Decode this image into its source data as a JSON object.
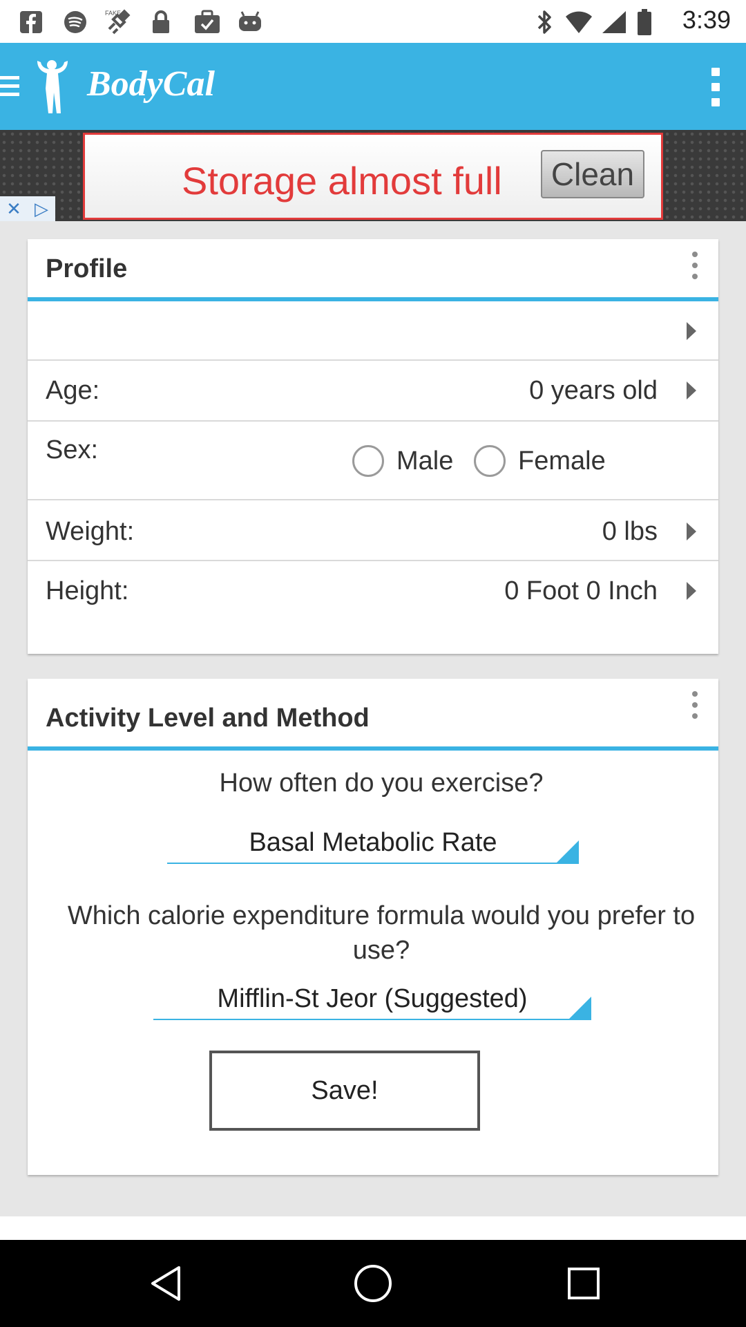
{
  "status_bar": {
    "time": "3:39",
    "left_icons": [
      "facebook-icon",
      "spotify-icon",
      "fake-gps-icon",
      "lock-icon",
      "briefcase-check-icon",
      "android-icon"
    ],
    "right_icons": [
      "bluetooth-icon",
      "wifi-signal-icon",
      "cell-signal-icon",
      "battery-icon"
    ]
  },
  "app_bar": {
    "title": "BodyCal",
    "menu_icon": "hamburger-icon",
    "logo_icon": "bodybuilder-icon",
    "overflow_icon": "more-vert-icon"
  },
  "ad": {
    "text": "Storage almost full",
    "button": "Clean"
  },
  "profile": {
    "title": "Profile",
    "name_value": "",
    "age_label": "Age:",
    "age_value": "0 years old",
    "sex_label": "Sex:",
    "sex_options": [
      "Male",
      "Female"
    ],
    "weight_label": "Weight:",
    "weight_value": "0 lbs",
    "height_label": "Height:",
    "height_value": "0 Foot 0 Inch"
  },
  "activity": {
    "title": "Activity Level and Method",
    "exercise_question": "How often do you exercise?",
    "exercise_selected": "Basal Metabolic Rate",
    "formula_question": "Which calorie expenditure formula would you prefer to use?",
    "formula_selected": "Mifflin-St Jeor (Suggested)",
    "save_label": "Save!"
  },
  "colors": {
    "accent": "#3ab3e3",
    "background": "#e6e6e6",
    "ad_red": "#e23b3b"
  }
}
